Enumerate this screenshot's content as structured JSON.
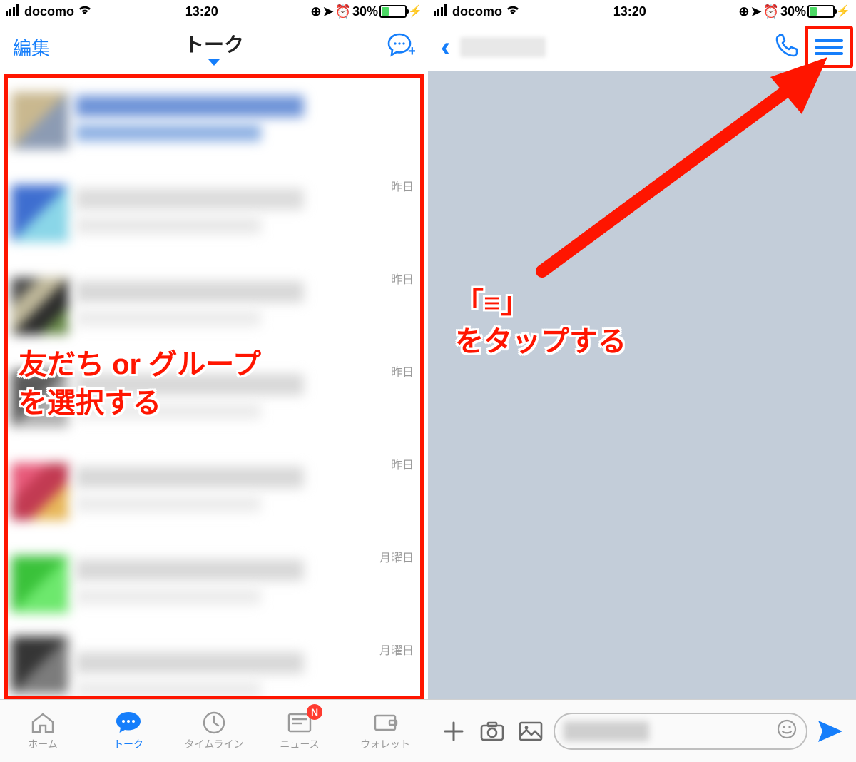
{
  "status": {
    "carrier": "docomo",
    "time": "13:20",
    "battery_pct": "30%"
  },
  "left": {
    "edit": "編集",
    "title": "トーク",
    "list_times": [
      "",
      "昨日",
      "昨日",
      "昨日",
      "昨日",
      "月曜日",
      "月曜日"
    ],
    "tabs": [
      {
        "label": "ホーム"
      },
      {
        "label": "トーク"
      },
      {
        "label": "タイムライン"
      },
      {
        "label": "ニュース",
        "badge": "N"
      },
      {
        "label": "ウォレット"
      }
    ]
  },
  "annotations": {
    "left_line1": "友だち or グループ",
    "left_line2": "を選択する",
    "right_line1": "「≡」",
    "right_line2": "をタップする"
  }
}
